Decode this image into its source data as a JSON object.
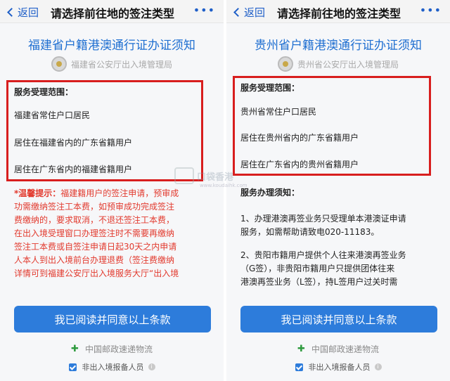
{
  "left": {
    "nav": {
      "back": "返回",
      "title": "请选择前往地的签注类型",
      "more": "•••"
    },
    "doc_title": "福建省户籍港澳通行证办证须知",
    "sub_title": "福建省公安厅出入境管理局",
    "scope_label": "服务受理范围：",
    "scope_items": [
      "福建省常住户口居民",
      "居住在福建省内的广东省籍用户",
      "居住在广东省内的福建省籍用户"
    ],
    "warning_prefix": "*温馨提示：",
    "warning_lines": [
      "福建籍用户的签注申请，预审成",
      "功需缴纳签注工本费，如预审成功完成签注",
      "费缴纳的，要求取消，不退还签注工本费，",
      "在出入境受理窗口办理签注时不需要再缴纳",
      "签注工本费或自签注申请日起30天之内申请",
      "人本人到出入境前台办理退费（签注费缴纳",
      "详情可到福建公安厅出入境服务大厅“出入境"
    ],
    "agree_button": "我已阅读并同意以上条款",
    "postal": "中国邮政速递物流",
    "checkbox_label": "非出入境报备人员"
  },
  "right": {
    "nav": {
      "back": "返回",
      "title": "请选择前往地的签注类型",
      "more": "•••"
    },
    "doc_title": "贵州省户籍港澳通行证办证须知",
    "sub_title": "贵州省公安厅出入境管理局",
    "scope_label": "服务受理范围：",
    "scope_items": [
      "贵州省常住户口居民",
      "居住在贵州省内的广东省籍用户",
      "居住在广东省内的贵州省籍用户"
    ],
    "notice_label": "服务办理须知：",
    "notice_lines": [
      "1、办理港澳再签业务只受理单本港澳证申请",
      "服务，如需帮助请致电020-11183。",
      "2、贵阳市籍用户提供个人往来港澳再签业务",
      "（G签），非贵阳市籍用户只提供团体往来",
      "港澳再签业务（L签），持L签用户过关时需"
    ],
    "agree_button": "我已阅读并同意以上条款",
    "postal": "中国邮政速递物流",
    "checkbox_label": "非出入境报备人员"
  },
  "watermark": {
    "text": "口袋香港",
    "url": "www.koudaihk.com"
  },
  "colors": {
    "accent": "#2d7cdb",
    "highlight_box": "#d81e1e",
    "warning": "#e23a2e",
    "title_blue": "#1f6fd1"
  }
}
